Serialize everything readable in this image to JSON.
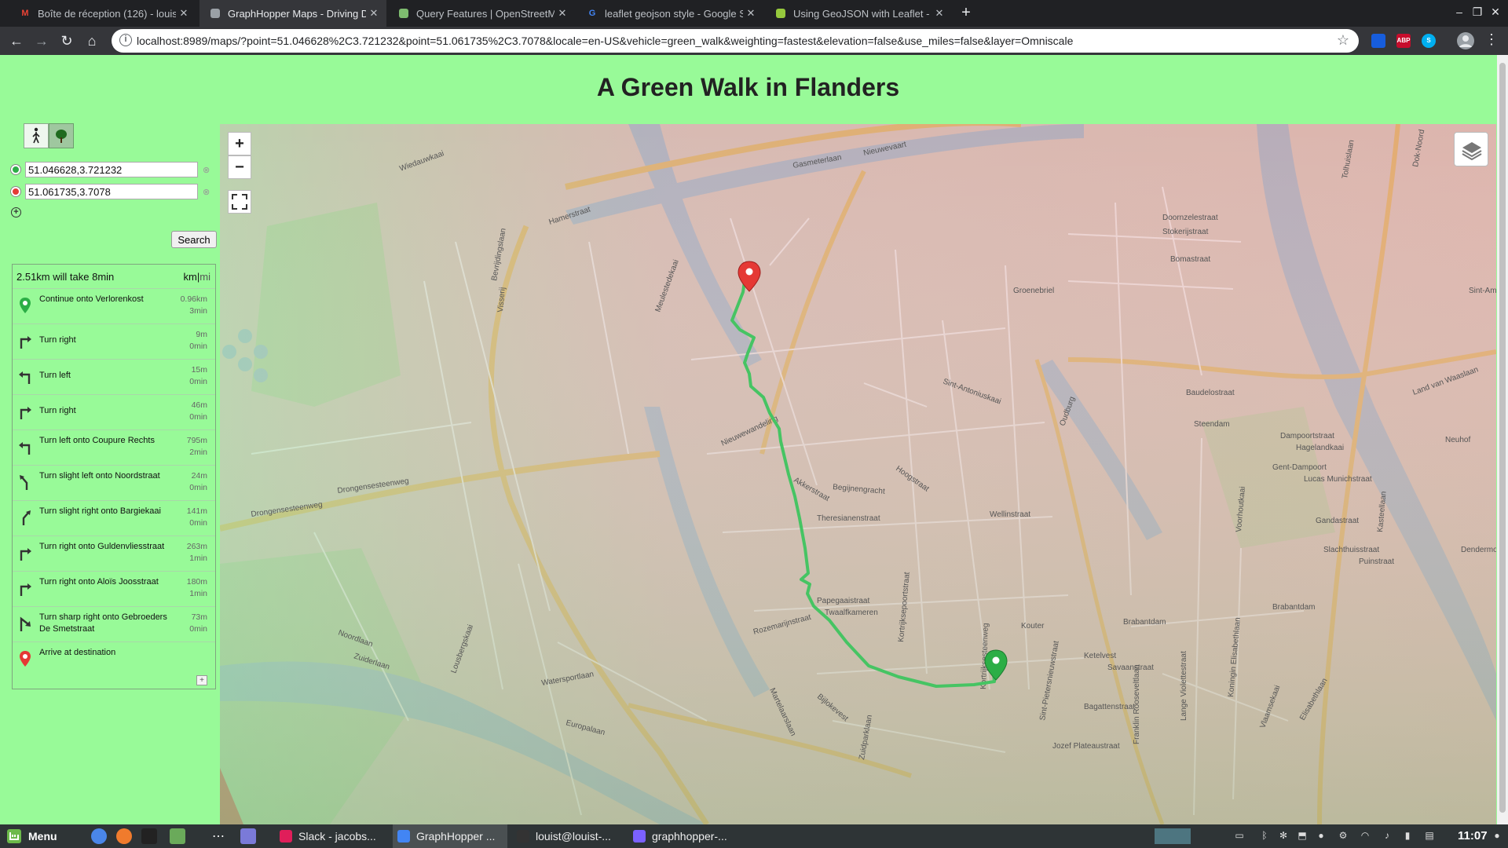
{
  "tabs": [
    {
      "title": "Boîte de réception (126) - louis",
      "favicon": "M",
      "favicon_color": "#ea4335",
      "active": false
    },
    {
      "title": "GraphHopper Maps - Driving Directions",
      "favicon": "",
      "favicon_color": "#9aa0a6",
      "active": true
    },
    {
      "title": "Query Features | OpenStreetMap",
      "favicon": "",
      "favicon_color": "#7ebc6f",
      "active": false
    },
    {
      "title": "leaflet geojson style - Google Search",
      "favicon": "G",
      "favicon_color": "#4285f4",
      "active": false
    },
    {
      "title": "Using GeoJSON with Leaflet - Leaflet",
      "favicon": "",
      "favicon_color": "#96c93d",
      "active": false
    }
  ],
  "new_tab_label": "+",
  "window_controls": {
    "minimize": "–",
    "maximize": "❐",
    "close": "✕"
  },
  "omnibox": {
    "url": "localhost:8989/maps/?point=51.046628%2C3.721232&point=51.061735%2C3.7078&locale=en-US&vehicle=green_walk&weighting=fastest&elevation=false&use_miles=false&layer=Omniscale",
    "info_icon": "i",
    "star_icon": "☆"
  },
  "nav": {
    "back": "←",
    "forward": "→",
    "reload": "↻",
    "home": "⌂"
  },
  "extensions": [
    {
      "name": "bitwarden",
      "label": "",
      "color": "#175ddc"
    },
    {
      "name": "adblock",
      "label": "ABP",
      "color": "#c70d2c"
    },
    {
      "name": "skype",
      "label": "S",
      "color": "#00aff0"
    }
  ],
  "page": {
    "title": "A Green Walk in Flanders"
  },
  "vehicles": [
    {
      "name": "walk",
      "icon": "person-walking-icon",
      "selected": false
    },
    {
      "name": "green_walk",
      "icon": "tree-icon",
      "selected": true
    }
  ],
  "points": [
    {
      "value": "51.046628,3.721232",
      "color": "#2cae46",
      "clear": "⊗"
    },
    {
      "value": "51.061735,3.7078",
      "color": "#e53935",
      "clear": "⊗"
    }
  ],
  "add_point_label": "+",
  "search_label": "Search",
  "route": {
    "summary": "2.51km will take 8min",
    "units": {
      "km": "km",
      "sep": "|",
      "mi": "mi"
    },
    "instructions": [
      {
        "icon": "marker-start-icon",
        "text": "Continue onto Verlorenkost",
        "distance": "0.96km",
        "time": "3min"
      },
      {
        "icon": "turn-right-icon",
        "text": "Turn right",
        "distance": "9m",
        "time": "0min"
      },
      {
        "icon": "turn-left-icon",
        "text": "Turn left",
        "distance": "15m",
        "time": "0min"
      },
      {
        "icon": "turn-right-icon",
        "text": "Turn right",
        "distance": "46m",
        "time": "0min"
      },
      {
        "icon": "turn-left-icon",
        "text": "Turn left onto Coupure Rechts",
        "distance": "795m",
        "time": "2min"
      },
      {
        "icon": "turn-slight-left-icon",
        "text": "Turn slight left onto Noordstraat",
        "distance": "24m",
        "time": "0min"
      },
      {
        "icon": "turn-slight-right-icon",
        "text": "Turn slight right onto Bargiekaai",
        "distance": "141m",
        "time": "0min"
      },
      {
        "icon": "turn-right-icon",
        "text": "Turn right onto Guldenvliesstraat",
        "distance": "263m",
        "time": "1min"
      },
      {
        "icon": "turn-right-icon",
        "text": "Turn right onto Aloïs Joosstraat",
        "distance": "180m",
        "time": "1min"
      },
      {
        "icon": "turn-sharp-right-icon",
        "text": "Turn sharp right onto Gebroeders De Smetstraat",
        "distance": "73m",
        "time": "0min"
      },
      {
        "icon": "marker-end-icon",
        "text": "Arrive at destination",
        "distance": "",
        "time": ""
      }
    ],
    "expand_label": "+"
  },
  "map": {
    "zoom_in": "+",
    "zoom_out": "−",
    "route_color": "#46c463",
    "labels": [
      "Nieuwevaart",
      "Gasmeterlaan",
      "Wiedauwkaai",
      "Hamerstraat",
      "Bevrijdingslaan",
      "Meulestedekaai",
      "Drongensesteenweg",
      "Drongensesteenweg",
      "Nieuwewandeling",
      "Akkerstraat",
      "Hoogstraat",
      "Theresianenstraat",
      "Papegaaistraat",
      "Twaalfkameren",
      "Kouter",
      "Brabantdam",
      "Brabantdam",
      "Ketelvest",
      "Savaanstraat",
      "Bagattenstraat",
      "Jozef Plateaustraat",
      "Noordlaan",
      "Zuiderlaan",
      "Watersportlaan",
      "Europalaan",
      "Rozemarijnstraat",
      "Martelaarslaan",
      "Bijlokevest",
      "Sint-Antoniuskaai",
      "Baudelostraat",
      "Steendam",
      "Dampoortstraat",
      "Hagelandkaai",
      "Lucas Munichstraat",
      "Gandastraat",
      "Slachthuisstraat",
      "Puinstraat",
      "Land van Waaslaan",
      "Neuhof",
      "Dendermondsesteenweg",
      "Sint-Am",
      "Doornzelestraat",
      "Stokerijstraat",
      "Bomastraat",
      "Groenebriel",
      "Oudburg",
      "Koningin Elisabethlaan",
      "Lange Violettestraat",
      "Franklin Rooseveltlaan",
      "Kortrijksesteenweg",
      "Sint-Pietersnieuwstraat",
      "Visserij",
      "Elisabethlaan",
      "Vlaamsekaai",
      "Dok-Noord",
      "Gent-Dampoort",
      "Wellinstraat",
      "Begijnengracht",
      "Kortrijksepoortstraat",
      "Zuidparklaan",
      "Lousbergskaai",
      "Tolhuislaan",
      "Voorhoutkaai",
      "Kasteellaan"
    ]
  },
  "taskbar": {
    "menu_label": "Menu",
    "items": [
      {
        "label": "Slack - jacobs...",
        "color": "#e01e5a",
        "active": false
      },
      {
        "label": "GraphHopper ...",
        "color": "#4285f4",
        "active": true
      },
      {
        "label": "louist@louist-...",
        "color": "#333",
        "active": false
      },
      {
        "label": "graphhopper-...",
        "color": "#7b61ff",
        "active": false
      }
    ],
    "ellipsis": "⋯",
    "clock": "11:07"
  }
}
